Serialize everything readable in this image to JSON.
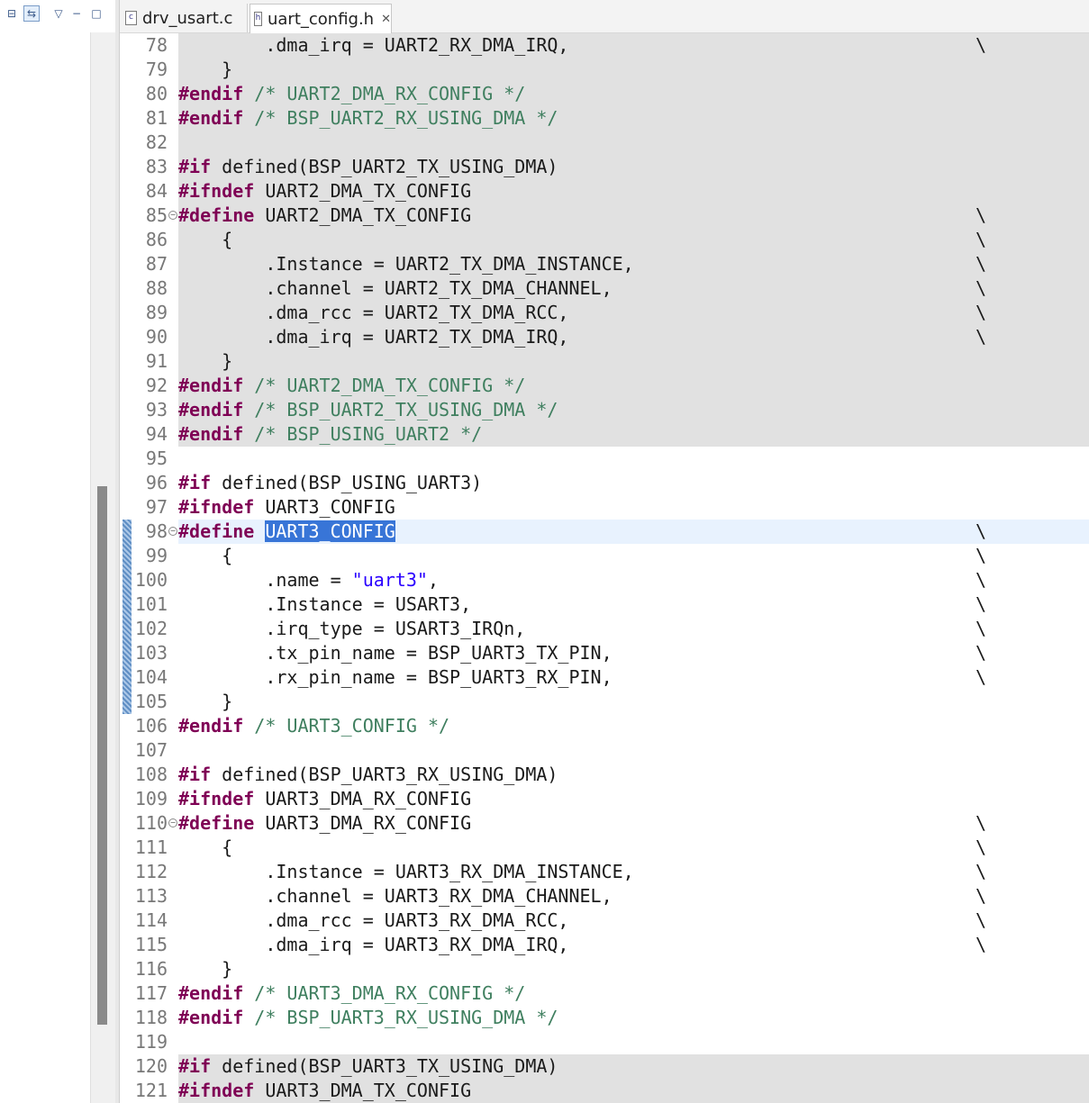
{
  "left_toolbar": {
    "icons": [
      "collapse-all-icon",
      "link-with-editor-icon",
      "view-menu-icon",
      "minimize-icon",
      "maximize-icon"
    ]
  },
  "tabs": [
    {
      "label": "drv_usart.c",
      "icon": "c-file-icon",
      "active": false
    },
    {
      "label": "uart_config.h",
      "icon": "h-file-icon",
      "active": true,
      "close": "✕"
    }
  ],
  "colors": {
    "preprocessor": "#7f0055",
    "comment": "#3f7f5f",
    "string": "#2a00ff",
    "inactive_region": "#e1e1e1",
    "selection": "#3875d7"
  },
  "editor": {
    "lines": [
      {
        "n": "78",
        "bs": true,
        "inactive": true,
        "segs": [
          [
            "        .dma_irq = UART2_RX_DMA_IRQ,",
            ""
          ]
        ]
      },
      {
        "n": "79",
        "inactive": true,
        "segs": [
          [
            "    }",
            ""
          ]
        ]
      },
      {
        "n": "80",
        "inactive": true,
        "segs": [
          [
            "#endif",
            "kw"
          ],
          [
            " ",
            ""
          ],
          [
            "/* UART2_DMA_RX_CONFIG */",
            "cm"
          ]
        ]
      },
      {
        "n": "81",
        "inactive": true,
        "segs": [
          [
            "#endif",
            "kw"
          ],
          [
            " ",
            ""
          ],
          [
            "/* BSP_UART2_RX_USING_DMA */",
            "cm"
          ]
        ]
      },
      {
        "n": "82",
        "inactive": true,
        "segs": []
      },
      {
        "n": "83",
        "inactive": true,
        "segs": [
          [
            "#if",
            "kw"
          ],
          [
            " defined(BSP_UART2_TX_USING_DMA)",
            ""
          ]
        ]
      },
      {
        "n": "84",
        "inactive": true,
        "segs": [
          [
            "#ifndef",
            "kw"
          ],
          [
            " UART2_DMA_TX_CONFIG",
            ""
          ]
        ]
      },
      {
        "n": "85",
        "fold": true,
        "bs": true,
        "inactive": true,
        "segs": [
          [
            "#define",
            "kw"
          ],
          [
            " UART2_DMA_TX_CONFIG",
            ""
          ]
        ]
      },
      {
        "n": "86",
        "bs": true,
        "inactive": true,
        "segs": [
          [
            "    {",
            ""
          ]
        ]
      },
      {
        "n": "87",
        "bs": true,
        "inactive": true,
        "segs": [
          [
            "        .Instance = UART2_TX_DMA_INSTANCE,",
            ""
          ]
        ]
      },
      {
        "n": "88",
        "bs": true,
        "inactive": true,
        "segs": [
          [
            "        .channel = UART2_TX_DMA_CHANNEL,",
            ""
          ]
        ]
      },
      {
        "n": "89",
        "bs": true,
        "inactive": true,
        "segs": [
          [
            "        .dma_rcc = UART2_TX_DMA_RCC,",
            ""
          ]
        ]
      },
      {
        "n": "90",
        "bs": true,
        "inactive": true,
        "segs": [
          [
            "        .dma_irq = UART2_TX_DMA_IRQ,",
            ""
          ]
        ]
      },
      {
        "n": "91",
        "inactive": true,
        "segs": [
          [
            "    }",
            ""
          ]
        ]
      },
      {
        "n": "92",
        "inactive": true,
        "segs": [
          [
            "#endif",
            "kw"
          ],
          [
            " ",
            ""
          ],
          [
            "/* UART2_DMA_TX_CONFIG */",
            "cm"
          ]
        ]
      },
      {
        "n": "93",
        "inactive": true,
        "segs": [
          [
            "#endif",
            "kw"
          ],
          [
            " ",
            ""
          ],
          [
            "/* BSP_UART2_TX_USING_DMA */",
            "cm"
          ]
        ]
      },
      {
        "n": "94",
        "inactive": true,
        "segs": [
          [
            "#endif",
            "kw"
          ],
          [
            " ",
            ""
          ],
          [
            "/* BSP_USING_UART2 */",
            "cm"
          ]
        ]
      },
      {
        "n": "95",
        "segs": []
      },
      {
        "n": "96",
        "segs": [
          [
            "#if",
            "kw"
          ],
          [
            " defined(BSP_USING_UART3)",
            ""
          ]
        ]
      },
      {
        "n": "97",
        "segs": [
          [
            "#ifndef",
            "kw"
          ],
          [
            " UART3_CONFIG",
            ""
          ]
        ]
      },
      {
        "n": "98",
        "fold": true,
        "bs": true,
        "current": true,
        "segs": [
          [
            "#define",
            "kw"
          ],
          [
            " ",
            ""
          ],
          [
            "UART3_CONFIG",
            "sel"
          ]
        ]
      },
      {
        "n": "99",
        "bs": true,
        "segs": [
          [
            "    {",
            ""
          ]
        ]
      },
      {
        "n": "100",
        "bs": true,
        "segs": [
          [
            "        .name = ",
            ""
          ],
          [
            "\"uart3\"",
            "str"
          ],
          [
            ",",
            ""
          ]
        ]
      },
      {
        "n": "101",
        "bs": true,
        "segs": [
          [
            "        .Instance = USART3,",
            ""
          ]
        ]
      },
      {
        "n": "102",
        "bs": true,
        "segs": [
          [
            "        .irq_type = USART3_IRQn,",
            ""
          ]
        ]
      },
      {
        "n": "103",
        "bs": true,
        "segs": [
          [
            "        .tx_pin_name = BSP_UART3_TX_PIN,",
            ""
          ]
        ]
      },
      {
        "n": "104",
        "bs": true,
        "segs": [
          [
            "        .rx_pin_name = BSP_UART3_RX_PIN,",
            ""
          ]
        ]
      },
      {
        "n": "105",
        "segs": [
          [
            "    }",
            ""
          ]
        ]
      },
      {
        "n": "106",
        "segs": [
          [
            "#endif",
            "kw"
          ],
          [
            " ",
            ""
          ],
          [
            "/* UART3_CONFIG */",
            "cm"
          ]
        ]
      },
      {
        "n": "107",
        "segs": []
      },
      {
        "n": "108",
        "segs": [
          [
            "#if",
            "kw"
          ],
          [
            " defined(BSP_UART3_RX_USING_DMA)",
            ""
          ]
        ]
      },
      {
        "n": "109",
        "segs": [
          [
            "#ifndef",
            "kw"
          ],
          [
            " UART3_DMA_RX_CONFIG",
            ""
          ]
        ]
      },
      {
        "n": "110",
        "fold": true,
        "bs": true,
        "segs": [
          [
            "#define",
            "kw"
          ],
          [
            " UART3_DMA_RX_CONFIG",
            ""
          ]
        ]
      },
      {
        "n": "111",
        "bs": true,
        "segs": [
          [
            "    {",
            ""
          ]
        ]
      },
      {
        "n": "112",
        "bs": true,
        "segs": [
          [
            "        .Instance = UART3_RX_DMA_INSTANCE,",
            ""
          ]
        ]
      },
      {
        "n": "113",
        "bs": true,
        "segs": [
          [
            "        .channel = UART3_RX_DMA_CHANNEL,",
            ""
          ]
        ]
      },
      {
        "n": "114",
        "bs": true,
        "segs": [
          [
            "        .dma_rcc = UART3_RX_DMA_RCC,",
            ""
          ]
        ]
      },
      {
        "n": "115",
        "bs": true,
        "segs": [
          [
            "        .dma_irq = UART3_RX_DMA_IRQ,",
            ""
          ]
        ]
      },
      {
        "n": "116",
        "segs": [
          [
            "    }",
            ""
          ]
        ]
      },
      {
        "n": "117",
        "segs": [
          [
            "#endif",
            "kw"
          ],
          [
            " ",
            ""
          ],
          [
            "/* UART3_DMA_RX_CONFIG */",
            "cm"
          ]
        ]
      },
      {
        "n": "118",
        "segs": [
          [
            "#endif",
            "kw"
          ],
          [
            " ",
            ""
          ],
          [
            "/* BSP_UART3_RX_USING_DMA */",
            "cm"
          ]
        ]
      },
      {
        "n": "119",
        "segs": []
      },
      {
        "n": "120",
        "inactive": true,
        "segs": [
          [
            "#if",
            "kw"
          ],
          [
            " defined(BSP_UART3_TX_USING_DMA)",
            ""
          ]
        ]
      },
      {
        "n": "121",
        "inactive": true,
        "segs": [
          [
            "#ifndef",
            "kw"
          ],
          [
            " UART3_DMA_TX_CONFIG",
            ""
          ]
        ]
      }
    ],
    "backslash": "\\"
  }
}
